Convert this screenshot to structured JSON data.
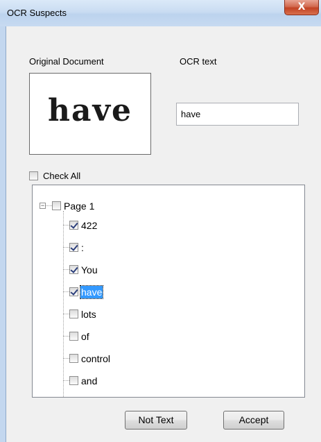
{
  "window": {
    "title": "OCR Suspects",
    "close_glyph": "X"
  },
  "labels": {
    "original_document": "Original Document",
    "ocr_text": "OCR text",
    "check_all": "Check All"
  },
  "preview": {
    "word": "have"
  },
  "ocr_input": {
    "value": "have"
  },
  "check_all": {
    "checked": false
  },
  "tree": {
    "root": {
      "label": "Page 1",
      "checked": false,
      "expanded": true
    },
    "items": [
      {
        "label": "422",
        "checked": true,
        "selected": false
      },
      {
        "label": ":",
        "checked": true,
        "selected": false
      },
      {
        "label": "You",
        "checked": true,
        "selected": false
      },
      {
        "label": "have",
        "checked": true,
        "selected": true
      },
      {
        "label": "lots",
        "checked": false,
        "selected": false
      },
      {
        "label": "of",
        "checked": false,
        "selected": false
      },
      {
        "label": "control",
        "checked": false,
        "selected": false
      },
      {
        "label": "and",
        "checked": false,
        "selected": false
      }
    ]
  },
  "buttons": {
    "not_text": "Not Text",
    "accept": "Accept"
  },
  "icons": {
    "expander": "minus-box-icon",
    "scroll_up": "scroll-up-arrow-icon",
    "scroll_down": "scroll-down-arrow-icon",
    "close": "close-icon"
  },
  "colors": {
    "selection": "#3399ff",
    "close_button": "#c24324",
    "titlebar": "#c9dcf2"
  }
}
